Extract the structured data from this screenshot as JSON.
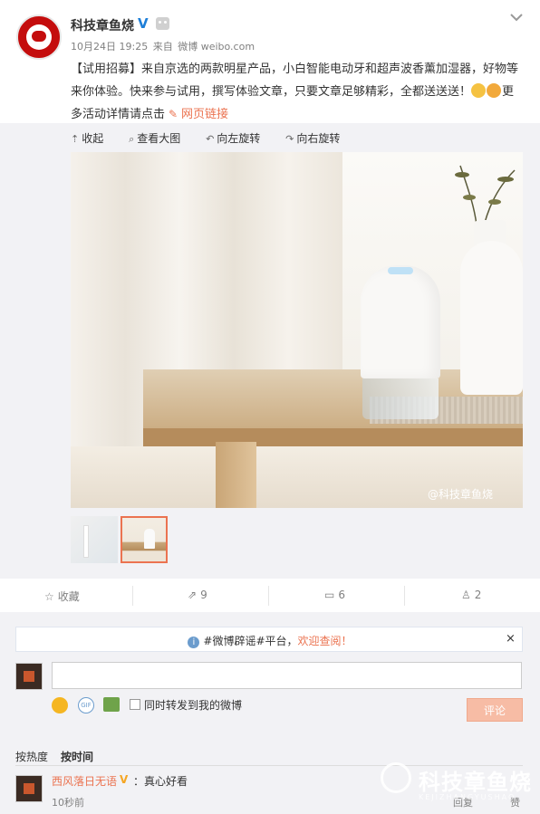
{
  "post": {
    "author": "科技章鱼烧",
    "verified_mark": "V",
    "date": "10月24日 19:25",
    "source_prefix": "来自",
    "source": "微博 weibo.com",
    "text_part1": "【试用招募】来自京选的两款明星产品，小白智能电动牙和超声波香薰加湿器，好物等来你体验。快来参与试用，撰写体验文章，只要文章足够精彩，全都送送送！",
    "text_part2": "更多活动详情请点击",
    "link_label": "网页链接"
  },
  "media_toolbar": {
    "collapse": "收起",
    "view_large": "查看大图",
    "rotate_left": "向左旋转",
    "rotate_right": "向右旋转"
  },
  "photo": {
    "watermark": "@科技章鱼烧"
  },
  "actions": {
    "favorite": "收藏",
    "forward_count": "9",
    "comment_count": "6",
    "like_count": "2"
  },
  "comment_box": {
    "notice_pre": "#微博辟谣#平台，",
    "notice_hl": "欢迎查阅！",
    "close": "×",
    "input_value": "",
    "gif_label": "GIF",
    "forward_checkbox_label": "同时转发到我的微博",
    "submit": "评论"
  },
  "sort": {
    "by_hot": "按热度",
    "by_time": "按时间"
  },
  "comments": [
    {
      "user": "西风落日无语",
      "vip": "V",
      "text": "：真心好看",
      "time": "10秒前",
      "reply": "回复",
      "like": "赞"
    }
  ],
  "brand_watermark": {
    "text": "科技章鱼烧",
    "sub": "KEJIZHANGYUSHAO"
  },
  "colors": {
    "accent": "#eb7350",
    "verified": "#1e7fd8",
    "background": "#f2f2f5"
  }
}
